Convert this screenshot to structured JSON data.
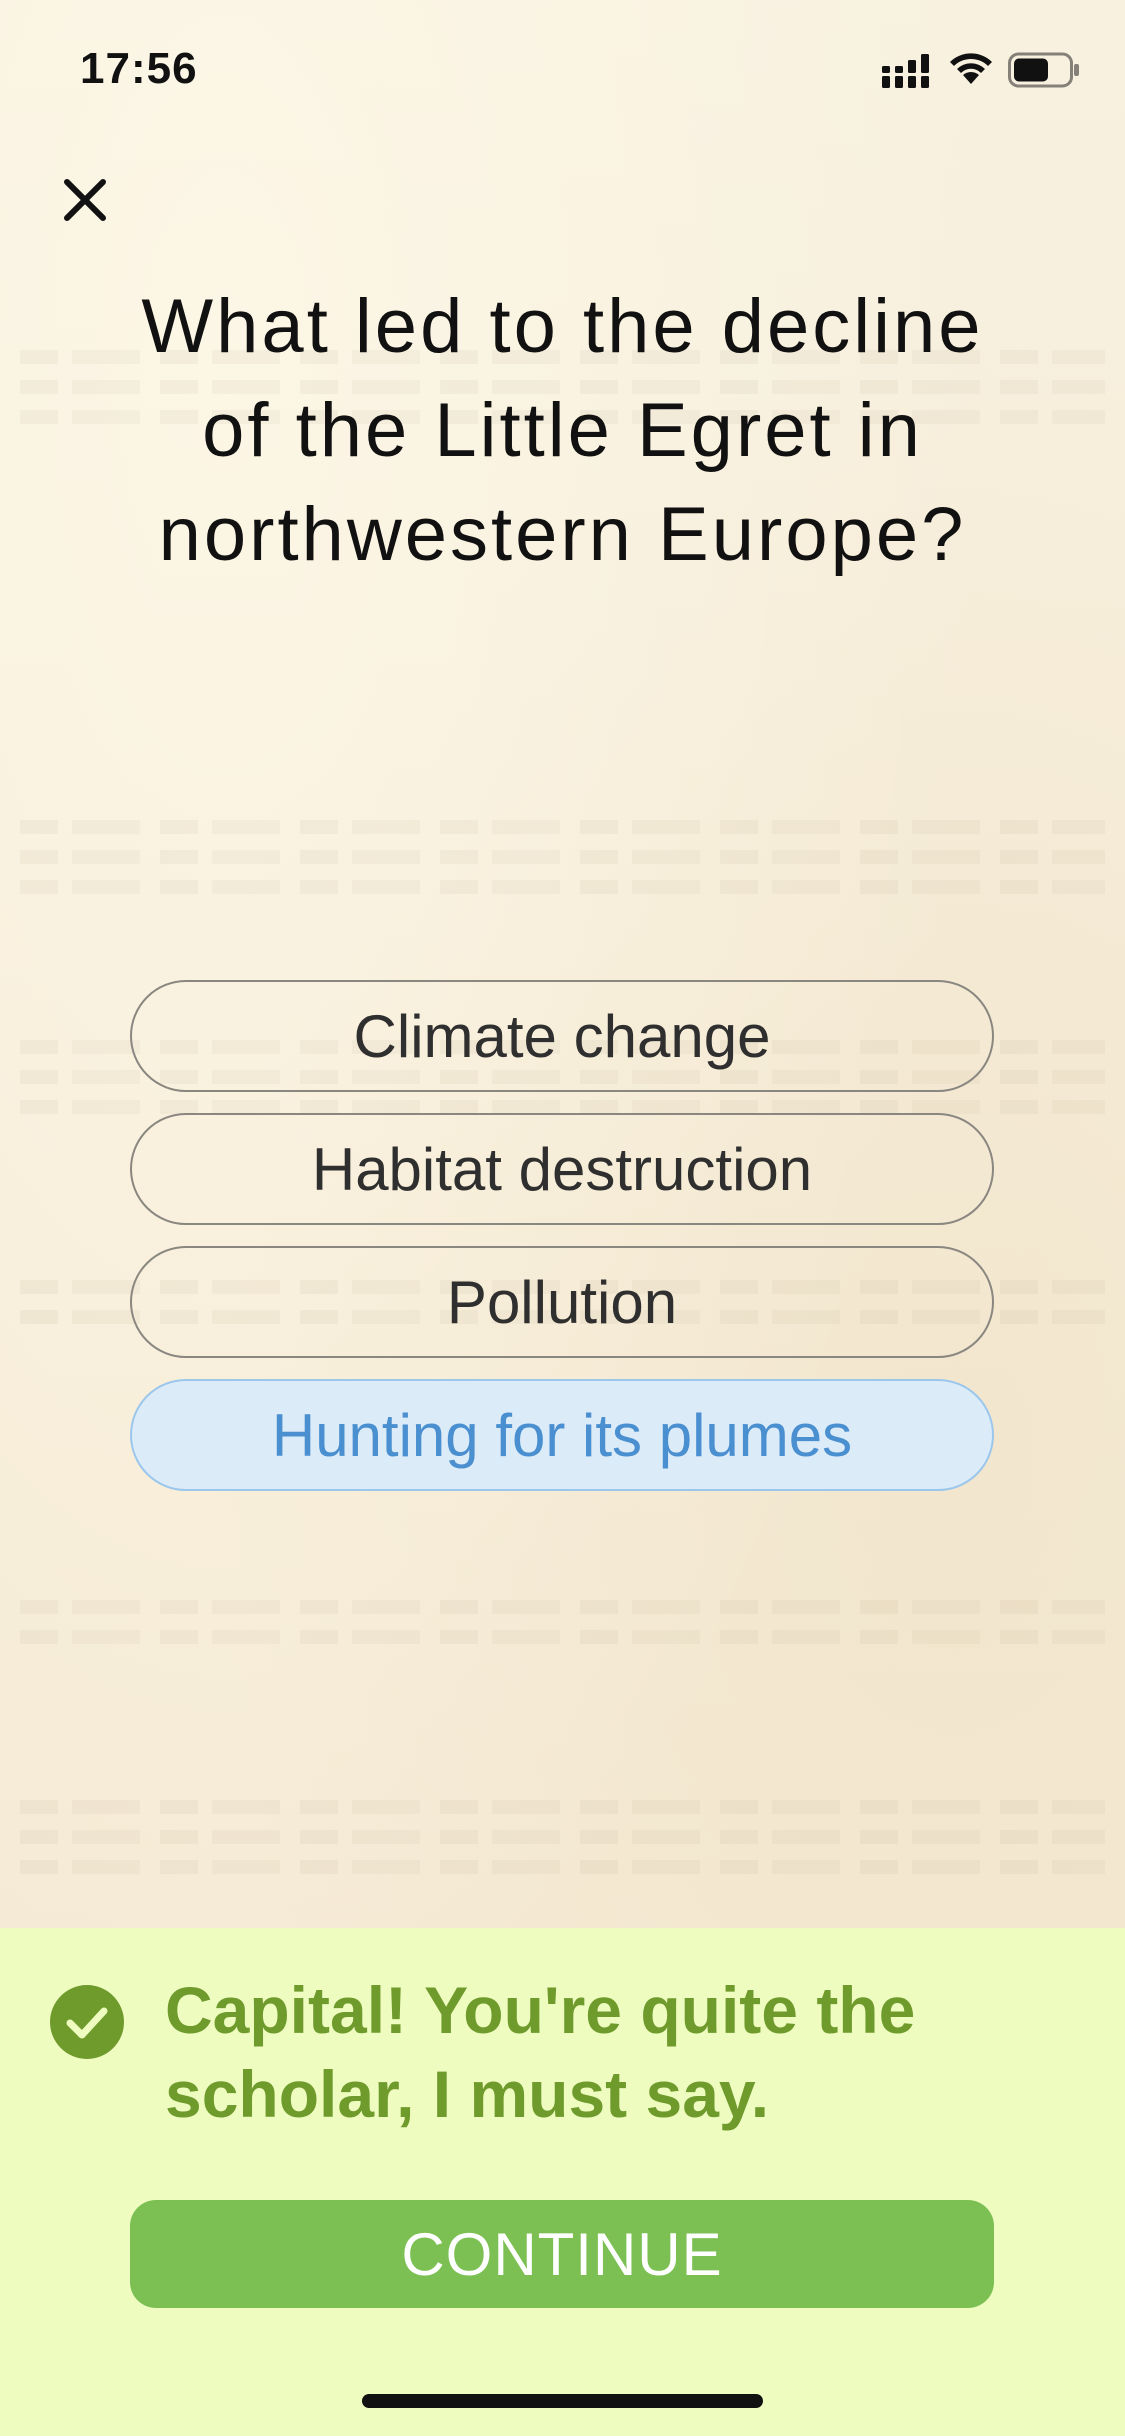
{
  "status_bar": {
    "time": "17:56",
    "icons": [
      "signal-icon",
      "wifi-icon",
      "battery-icon"
    ]
  },
  "header": {
    "close_icon": "close-icon"
  },
  "question": {
    "text": "What led to the decline of the Little Egret in northwestern Europe?"
  },
  "answers": [
    {
      "label": "Climate change",
      "selected": false
    },
    {
      "label": "Habitat destruction",
      "selected": false
    },
    {
      "label": "Pollution",
      "selected": false
    },
    {
      "label": "Hunting for its plumes",
      "selected": true
    }
  ],
  "feedback": {
    "icon": "check-circle-icon",
    "message": "Capital! You're quite the scholar, I must say.",
    "continue_label": "CONTINUE"
  },
  "colors": {
    "feedback_background": "#eefcc0",
    "feedback_text": "#6f9a2c",
    "continue_button": "#7cc054",
    "selected_background": "#dcebf8",
    "selected_text": "#4a8fd0"
  }
}
